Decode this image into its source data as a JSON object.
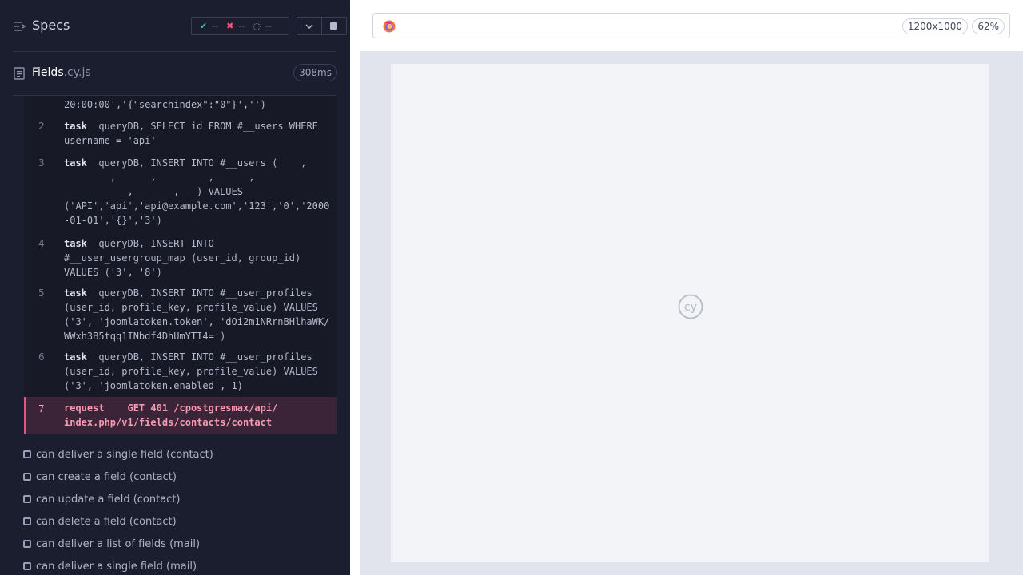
{
  "reporter": {
    "title": "Specs",
    "stats": {
      "passed": "--",
      "failed": "--",
      "pending": "--"
    },
    "spec": {
      "name": "Fields",
      "ext": ".cy.js",
      "duration": "308ms"
    },
    "commands": [
      {
        "num": "",
        "keyword": "",
        "text": "20:00:00','{\"searchindex\":\"0\"}','')"
      },
      {
        "num": "2",
        "keyword": "task",
        "text": "  queryDB, SELECT id FROM #__users WHERE\nusername = 'api'"
      },
      {
        "num": "3",
        "keyword": "task",
        "text": "  queryDB, INSERT INTO #__users (    ,\n        ,      ,         ,      ,\n           ,       ,   ) VALUES\n('API','api','api@example.com','123','0','2000\n-01-01','{}','3')"
      },
      {
        "num": "4",
        "keyword": "task",
        "text": "  queryDB, INSERT INTO\n#__user_usergroup_map (user_id, group_id)\nVALUES ('3', '8')"
      },
      {
        "num": "5",
        "keyword": "task",
        "text": "  queryDB, INSERT INTO #__user_profiles\n(user_id, profile_key, profile_value) VALUES\n('3', 'joomlatoken.token', 'dOi2m1NRrnBHlhaWK/\nWWxh3B5tqq1INbdf4DhUmYTI4=')"
      },
      {
        "num": "6",
        "keyword": "task",
        "text": "  queryDB, INSERT INTO #__user_profiles\n(user_id, profile_key, profile_value) VALUES\n('3', 'joomlatoken.enabled', 1)"
      },
      {
        "num": "7",
        "keyword": "request",
        "text": "    GET 401 /cpostgresmax/api/\nindex.php/v1/fields/contacts/contact"
      }
    ],
    "tests": [
      "can deliver a single field (contact)",
      "can create a field (contact)",
      "can update a field (contact)",
      "can delete a field (contact)",
      "can deliver a list of fields (mail)",
      "can deliver a single field (mail)"
    ]
  },
  "aut": {
    "viewport": "1200x1000",
    "zoom": "62%",
    "browser_icon": "firefox-icon",
    "center_logo": "cypress-logo"
  },
  "colors": {
    "pass": "#3cc49f",
    "fail": "#f15c77",
    "failed_command_bg": "#3b2437"
  }
}
